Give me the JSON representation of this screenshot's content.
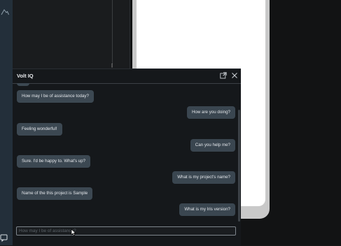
{
  "chat": {
    "title": "Volt IQ",
    "input_placeholder": "How may I be of assistance?",
    "messages": [
      {
        "role": "bot",
        "text": "How may I be of assistance today?"
      },
      {
        "role": "user",
        "text": "How are you doing?"
      },
      {
        "role": "bot",
        "text": "Feeling wonderful!"
      },
      {
        "role": "user",
        "text": "Can you help me?"
      },
      {
        "role": "bot",
        "text": "Sure. I'd be happy to. What's up?"
      },
      {
        "role": "user",
        "text": "What is my project's name?"
      },
      {
        "role": "bot",
        "text": "Name of the this project is Sample"
      },
      {
        "role": "user",
        "text": "What is my Iris version?"
      }
    ],
    "icons": {
      "popout": "open-external-icon",
      "close": "close-icon"
    }
  },
  "colors": {
    "panel_bg": "#15181b",
    "bubble_bg": "#3c4852",
    "rail_bg": "#232f3a"
  }
}
